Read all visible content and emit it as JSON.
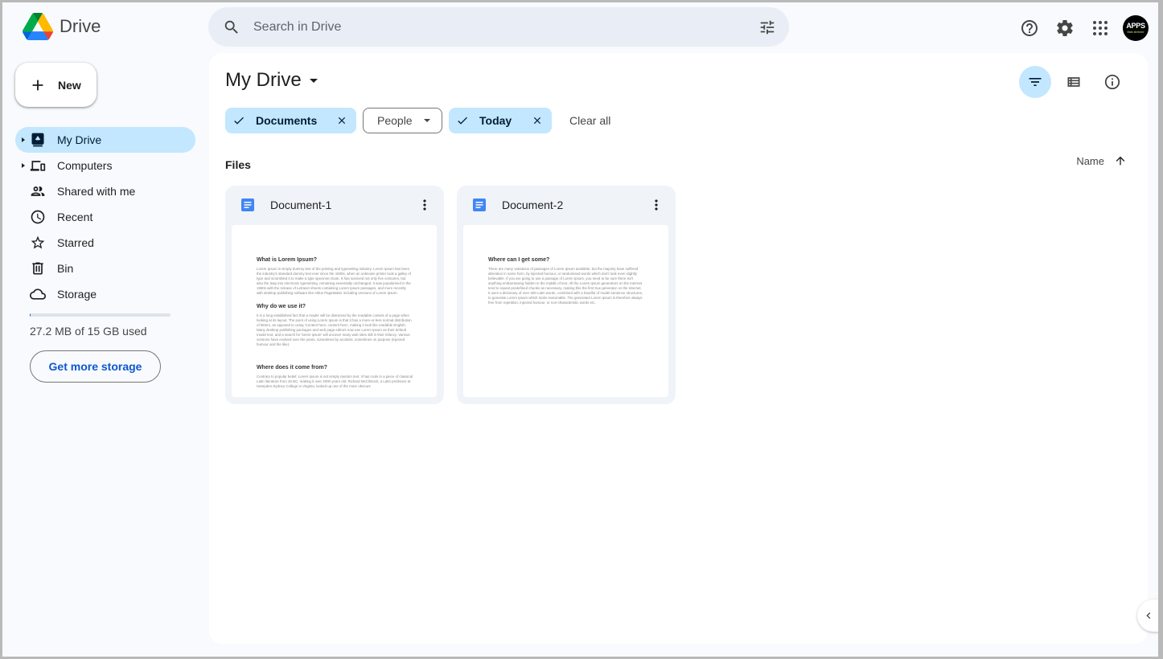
{
  "app": {
    "name": "Drive"
  },
  "search": {
    "placeholder": "Search in Drive",
    "value": ""
  },
  "header": {
    "icons": [
      "help-icon",
      "settings-icon",
      "apps-grid-icon"
    ],
    "avatar": {
      "line1": "APPS",
      "line2": "that deliver"
    }
  },
  "sidebar": {
    "new_label": "New",
    "items": [
      {
        "label": "My Drive",
        "icon": "my-drive-icon",
        "expandable": true,
        "active": true
      },
      {
        "label": "Computers",
        "icon": "computers-icon",
        "expandable": true,
        "active": false
      },
      {
        "label": "Shared with me",
        "icon": "people-icon",
        "expandable": false,
        "active": false
      },
      {
        "label": "Recent",
        "icon": "clock-icon",
        "expandable": false,
        "active": false
      },
      {
        "label": "Starred",
        "icon": "star-icon",
        "expandable": false,
        "active": false
      },
      {
        "label": "Bin",
        "icon": "trash-icon",
        "expandable": false,
        "active": false
      },
      {
        "label": "Storage",
        "icon": "cloud-icon",
        "expandable": false,
        "active": false
      }
    ],
    "storage": {
      "used_text": "27.2 MB of 15 GB used",
      "used_fraction": 0.0018,
      "get_more_label": "Get more storage"
    }
  },
  "main": {
    "title": "My Drive",
    "view_buttons": [
      "filter-icon",
      "list-view-icon",
      "info-icon"
    ],
    "filters": [
      {
        "label": "Documents",
        "selected": true
      },
      {
        "label": "People",
        "selected": false,
        "dropdown": true
      },
      {
        "label": "Today",
        "selected": true
      }
    ],
    "clear_all_label": "Clear all",
    "section_label": "Files",
    "sort": {
      "label": "Name",
      "direction": "ascending"
    },
    "files": [
      {
        "name": "Document-1",
        "type": "Google Docs",
        "preview": [
          {
            "heading": "What is Lorem Ipsum?",
            "text": "Lorem Ipsum is simply dummy text of the printing and typesetting industry. Lorem Ipsum has been the industry's standard dummy text ever since the 1500s, when an unknown printer took a galley of type and scrambled it to make a type specimen book. It has survived not only five centuries, but also the leap into electronic typesetting, remaining essentially unchanged. It was popularised in the 1960s with the release of Letraset sheets containing Lorem Ipsum passages, and more recently with desktop publishing software like Aldus PageMaker including versions of Lorem Ipsum."
          },
          {
            "heading": "Why do we use it?",
            "text": "It is a long established fact that a reader will be distracted by the readable content of a page when looking at its layout. The point of using Lorem Ipsum is that it has a more-or-less normal distribution of letters, as opposed to using 'Content here, content here', making it look like readable English. Many desktop publishing packages and web page editors now use Lorem Ipsum as their default model text, and a search for 'lorem ipsum' will uncover many web sites still in their infancy. Various versions have evolved over the years, sometimes by accident, sometimes on purpose (injected humour and the like)."
          },
          {
            "heading": "Where does it come from?",
            "text": "Contrary to popular belief, Lorem Ipsum is not simply random text. It has roots in a piece of classical Latin literature from 45 BC, making it over 2000 years old. Richard McClintock, a Latin professor at Hampden-Sydney College in Virginia, looked up one of the more obscure"
          }
        ]
      },
      {
        "name": "Document-2",
        "type": "Google Docs",
        "preview": [
          {
            "heading": "Where can I get some?",
            "text": "There are many variations of passages of Lorem Ipsum available, but the majority have suffered alteration in some form, by injected humour, or randomised words which don't look even slightly believable. If you are going to use a passage of Lorem Ipsum, you need to be sure there isn't anything embarrassing hidden in the middle of text. All the Lorem Ipsum generators on the Internet tend to repeat predefined chunks as necessary, making this the first true generator on the Internet. It uses a dictionary of over 200 Latin words, combined with a handful of model sentence structures, to generate Lorem Ipsum which looks reasonable. The generated Lorem Ipsum is therefore always free from repetition, injected humour, or non-characteristic words etc."
          }
        ]
      }
    ]
  },
  "colors": {
    "accent": "#0b57d0",
    "selected_bg": "#c2e7ff",
    "page_bg": "#f8fafd",
    "search_bg": "#e9eef6",
    "card_bg": "#f0f4f9",
    "doc_icon": "#4285f4"
  }
}
